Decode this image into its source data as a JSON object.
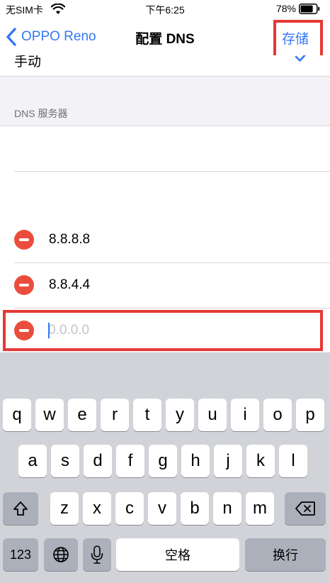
{
  "status_bar": {
    "carrier": "无SIM卡",
    "time": "下午6:25",
    "battery": "78%"
  },
  "nav": {
    "back_label": "OPPO Reno",
    "title": "配置 DNS",
    "save_label": "存储"
  },
  "manual_row": {
    "label": "手动"
  },
  "dns_section": {
    "header": "DNS 服务器",
    "servers": [
      "8.8.8.8",
      "8.8.4.4"
    ],
    "new_server_placeholder": "0.0.0.0"
  },
  "keyboard": {
    "row1": [
      "q",
      "w",
      "e",
      "r",
      "t",
      "y",
      "u",
      "i",
      "o",
      "p"
    ],
    "row2": [
      "a",
      "s",
      "d",
      "f",
      "g",
      "h",
      "j",
      "k",
      "l"
    ],
    "row3": [
      "z",
      "x",
      "c",
      "v",
      "b",
      "n",
      "m"
    ],
    "numbers_label": "123",
    "space_label": "空格",
    "return_label": "换行"
  },
  "colors": {
    "accent": "#3478f6",
    "delete_red": "#eb4d3d",
    "highlight": "#e53935"
  },
  "icons": {
    "status": [
      "wifi-icon",
      "battery-icon"
    ],
    "nav": [
      "chevron-left-icon",
      "checkmark-icon"
    ],
    "keyboard": [
      "shift-icon",
      "backspace-icon",
      "globe-icon",
      "microphone-icon"
    ]
  }
}
